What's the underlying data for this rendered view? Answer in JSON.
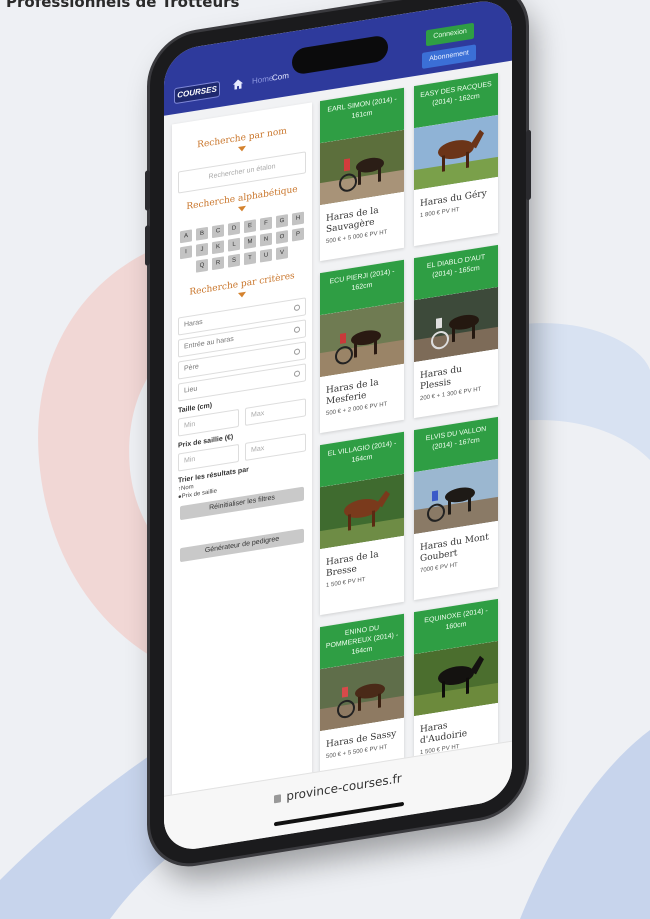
{
  "headline": "Professionnels de Trotteurs",
  "colors": {
    "brand_blue": "#2e3a9c",
    "green": "#2f9e44",
    "orange": "#c9752a"
  },
  "topbar": {
    "logo_text": "COURSES",
    "breadcrumb_link": "Home",
    "breadcrumb_current": "Com",
    "connect_label": "Connexion",
    "subscribe_label": "Abonnement"
  },
  "sidebar": {
    "search_name_title": "Recherche par nom",
    "search_placeholder": "Rechercher un étalon",
    "alpha_title": "Recherche alphabétique",
    "letters": [
      "A",
      "B",
      "C",
      "D",
      "E",
      "F",
      "G",
      "H",
      "I",
      "J",
      "K",
      "L",
      "M",
      "N",
      "O",
      "P",
      "Q",
      "R",
      "S",
      "T",
      "U",
      "V"
    ],
    "criteria_title": "Recherche par critères",
    "selects": [
      "Haras",
      "Entrée au haras",
      "Père",
      "Lieu"
    ],
    "size_label": "Taille (cm)",
    "size_min": "Min",
    "size_max": "Max",
    "price_label": "Prix de saillie (€)",
    "price_min": "Min",
    "price_max": "Max",
    "sort_label": "Trier les résultats par",
    "sort_options": [
      "Nom",
      "Prix de saillie"
    ],
    "reset_label": "Réinitialiser les filtres",
    "pedigree_label": "Générateur de pedigree"
  },
  "cards": [
    {
      "title": "EARL SIMON (2014) - 161cm",
      "haras": "Haras de la Sauvagère",
      "price": "500 € + 5 000 € PV HT",
      "img": "sulky"
    },
    {
      "title": "EASY DES RACQUES (2014) - 162cm",
      "haras": "Haras du Géry",
      "price": "1 800 € PV HT",
      "img": "horse"
    },
    {
      "title": "ECU PIERJI (2014) - 162cm",
      "haras": "Haras de la Mesferie",
      "price": "500 € + 2 000 € PV HT",
      "img": "sulky"
    },
    {
      "title": "EL DIABLO D'AUT (2014) - 165cm",
      "haras": "Haras du Plessis",
      "price": "200 € + 1 300 € PV HT",
      "img": "sulky"
    },
    {
      "title": "EL VILLAGIO (2014) - 164cm",
      "haras": "Haras de la Bresse",
      "price": "1 500 € PV HT",
      "img": "horse"
    },
    {
      "title": "ELVIS DU VALLON (2014) - 167cm",
      "haras": "Haras du Mont Goubert",
      "price": "7000 € PV HT",
      "img": "sulky"
    },
    {
      "title": "ENINO DU POMMEREUX (2014) - 164cm",
      "haras": "Haras de Sassy",
      "price": "500 € + 5 500 € PV HT",
      "img": "sulky"
    },
    {
      "title": "EQUINOXE (2014) - 160cm",
      "haras": "Haras d'Audoirie",
      "price": "1 500 € PV HT",
      "img": "horse"
    }
  ],
  "url": "province-courses.fr"
}
